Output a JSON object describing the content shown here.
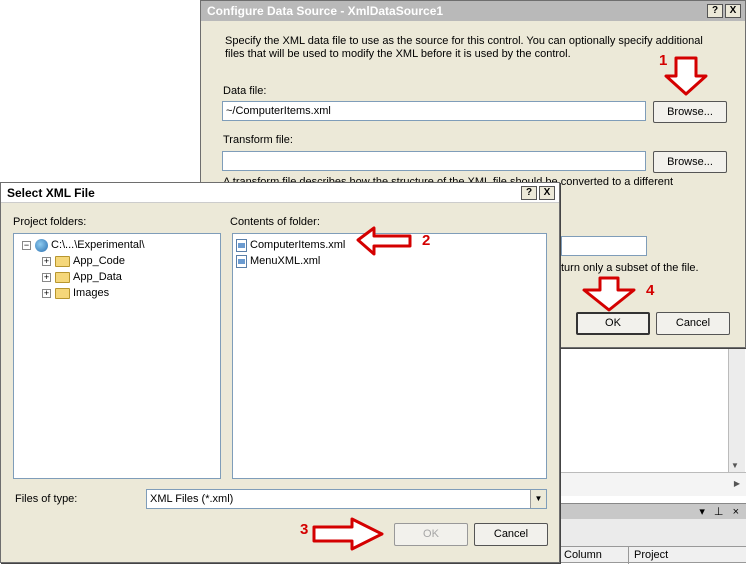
{
  "configure_dialog": {
    "title": "Configure Data Source - XmlDataSource1",
    "help_btn": "?",
    "close_btn": "X",
    "description": "Specify the XML data file to use as the source for this control. You can optionally specify additional files that will be used to modify the XML before it is used by the control.",
    "data_file_label": "Data file:",
    "data_file_value": "~/ComputerItems.xml",
    "browse_label": "Browse...",
    "transform_file_label": "Transform file:",
    "transform_file_value": "",
    "transform_browse_label": "Browse...",
    "transform_desc_visible": "A transform file describes how the structure of the XML file should be converted to a different",
    "xpath_desc_visible": "turn only a subset of the file.",
    "ok_label": "OK",
    "cancel_label": "Cancel"
  },
  "select_dialog": {
    "title": "Select XML File",
    "help_btn": "?",
    "close_btn": "X",
    "project_folders_label": "Project folders:",
    "contents_label": "Contents of folder:",
    "tree": [
      {
        "label": "C:\\...\\Experimental\\",
        "icon": "globe-icon",
        "expand": "−"
      },
      {
        "label": "App_Code",
        "icon": "folder-icon",
        "expand": "+"
      },
      {
        "label": "App_Data",
        "icon": "folder-icon",
        "expand": "+"
      },
      {
        "label": "Images",
        "icon": "folder-icon",
        "expand": "+"
      }
    ],
    "files": [
      "ComputerItems.xml",
      "MenuXML.xml"
    ],
    "files_of_type_label": "Files of type:",
    "files_of_type_value": "XML Files (*.xml)",
    "ok_label": "OK",
    "cancel_label": "Cancel"
  },
  "background": {
    "panel_buttons": "▾ ⊥ ×",
    "col_column": "Column",
    "col_project": "Project"
  },
  "annotations": {
    "step1": "1",
    "step2": "2",
    "step3": "3",
    "step4": "4",
    "color": "#d40000"
  }
}
